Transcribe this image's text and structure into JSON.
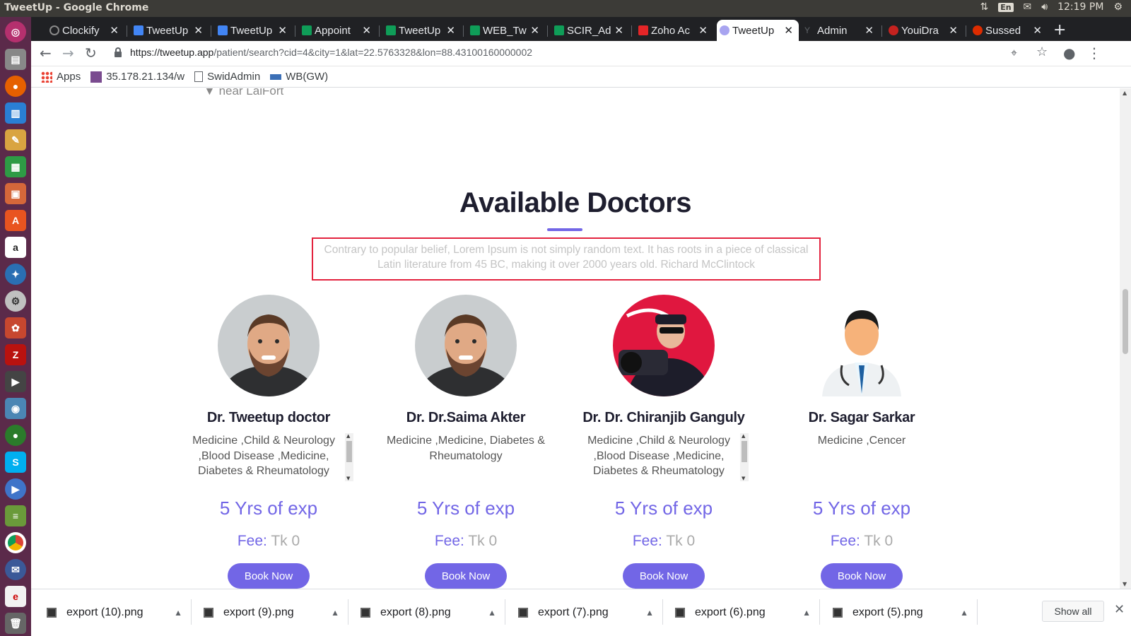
{
  "os": {
    "window_title": "TweetUp - Google Chrome",
    "keyboard": "En",
    "clock": "12:19 PM"
  },
  "browser": {
    "tabs": [
      {
        "label": "Clockify",
        "favicon_color": "#8a8a8a"
      },
      {
        "label": "TweetUp",
        "favicon_color": "#4285f4"
      },
      {
        "label": "TweetUp",
        "favicon_color": "#4285f4"
      },
      {
        "label": "Appoint",
        "favicon_color": "#0f9d58"
      },
      {
        "label": "TweetUp",
        "favicon_color": "#0f9d58"
      },
      {
        "label": "WEB_Tw",
        "favicon_color": "#0f9d58"
      },
      {
        "label": "SCIR_Ad",
        "favicon_color": "#0f9d58"
      },
      {
        "label": "Zoho Ac",
        "favicon_color": "#e42527"
      },
      {
        "label": "TweetUp",
        "favicon_color": "#a8a4f0",
        "active": true
      },
      {
        "label": "Admin",
        "favicon_color": "#5f6368"
      },
      {
        "label": "YouiDra",
        "favicon_color": "#c5221f"
      },
      {
        "label": "Sussed",
        "favicon_color": "#dd2c00"
      }
    ],
    "url_host": "https://tweetup.app",
    "url_path": "/patient/search?cid=4&city=1&lat=22.5763328&lon=88.43100160000002",
    "bookmarks": [
      {
        "label": "Apps"
      },
      {
        "label": "35.178.21.134/w"
      },
      {
        "label": "SwidAdmin"
      },
      {
        "label": "WB(GW)"
      }
    ]
  },
  "page": {
    "location_text": "near LalFort",
    "heading": "Available Doctors",
    "description": "Contrary to popular belief, Lorem Ipsum is not simply random text. It has roots in a piece of classical Latin literature from 45 BC, making it over 2000 years old. Richard McClintock",
    "accent_color": "#7266e6",
    "highlight_color": "#e3233e",
    "doctors": [
      {
        "name": "Dr. Tweetup doctor",
        "specialties": "Medicine ,Child & Neurology ,Blood Disease ,Medicine, Diabetes & Rheumatology Diabetes, Orthopedic &",
        "experience": "5 Yrs of exp",
        "fee_label": "Fee:",
        "fee_value": "Tk 0",
        "button": "Book Now"
      },
      {
        "name": "Dr. Dr.Saima Akter",
        "specialties": "Medicine ,Medicine, Diabetes & Rheumatology",
        "experience": "5 Yrs of exp",
        "fee_label": "Fee:",
        "fee_value": "Tk 0",
        "button": "Book Now"
      },
      {
        "name": "Dr. Dr. Chiranjib Ganguly",
        "specialties": "Medicine ,Child & Neurology ,Blood Disease ,Medicine, Diabetes & Rheumatology Psychiatrist",
        "experience": "5 Yrs of exp",
        "fee_label": "Fee:",
        "fee_value": "Tk 0",
        "button": "Book Now"
      },
      {
        "name": "Dr. Sagar Sarkar",
        "specialties": "Medicine ,Cencer",
        "experience": "5 Yrs of exp",
        "fee_label": "Fee:",
        "fee_value": "Tk 0",
        "button": "Book Now"
      }
    ]
  },
  "downloads": {
    "items": [
      {
        "label": "export (10).png"
      },
      {
        "label": "export (9).png"
      },
      {
        "label": "export (8).png"
      },
      {
        "label": "export (7).png"
      },
      {
        "label": "export (6).png"
      },
      {
        "label": "export (5).png"
      }
    ],
    "show_all": "Show all"
  }
}
